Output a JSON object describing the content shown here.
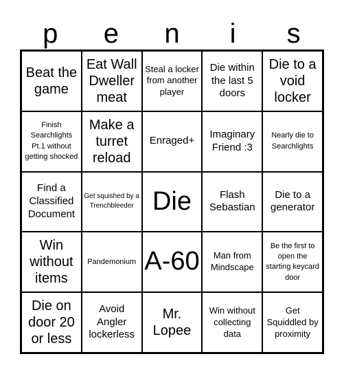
{
  "header": {
    "letters": [
      "p",
      "e",
      "n",
      "i",
      "s"
    ]
  },
  "cells": [
    {
      "text": "Beat the game",
      "size": "s-l"
    },
    {
      "text": "Eat Wall Dweller meat",
      "size": "s-l"
    },
    {
      "text": "Steal a locker from another player",
      "size": "s-s"
    },
    {
      "text": "Die within the last 5 doors",
      "size": "s-m"
    },
    {
      "text": "Die to a void locker",
      "size": "s-l"
    },
    {
      "text": "Finish Searchlights Pt.1 without getting shocked",
      "size": "s-xs"
    },
    {
      "text": "Make a turret reload",
      "size": "s-l"
    },
    {
      "text": "Enraged+",
      "size": "s-m"
    },
    {
      "text": "Imaginary Friend :3",
      "size": "s-m"
    },
    {
      "text": "Nearly die to Searchlights",
      "size": "s-xs"
    },
    {
      "text": "Find a Classified Document",
      "size": "s-m"
    },
    {
      "text": "Get squished by a Trenchbleeder",
      "size": "s-xxs"
    },
    {
      "text": "Die",
      "size": "s-xl"
    },
    {
      "text": "Flash Sebastian",
      "size": "s-m"
    },
    {
      "text": "Die to a generator",
      "size": "s-m"
    },
    {
      "text": "Win without items",
      "size": "s-l"
    },
    {
      "text": "Pandemonium",
      "size": "s-xs"
    },
    {
      "text": "A-60",
      "size": "s-xl"
    },
    {
      "text": "Man from Mindscape",
      "size": "s-s"
    },
    {
      "text": "Be the first to open the starting keycard door",
      "size": "s-xs"
    },
    {
      "text": "Die on door 20 or less",
      "size": "s-l"
    },
    {
      "text": "Avoid Angler lockerless",
      "size": "s-m"
    },
    {
      "text": "Mr. Lopee",
      "size": "s-l"
    },
    {
      "text": "Win without collecting data",
      "size": "s-s"
    },
    {
      "text": "Get Squiddled by proximity",
      "size": "s-s"
    }
  ]
}
